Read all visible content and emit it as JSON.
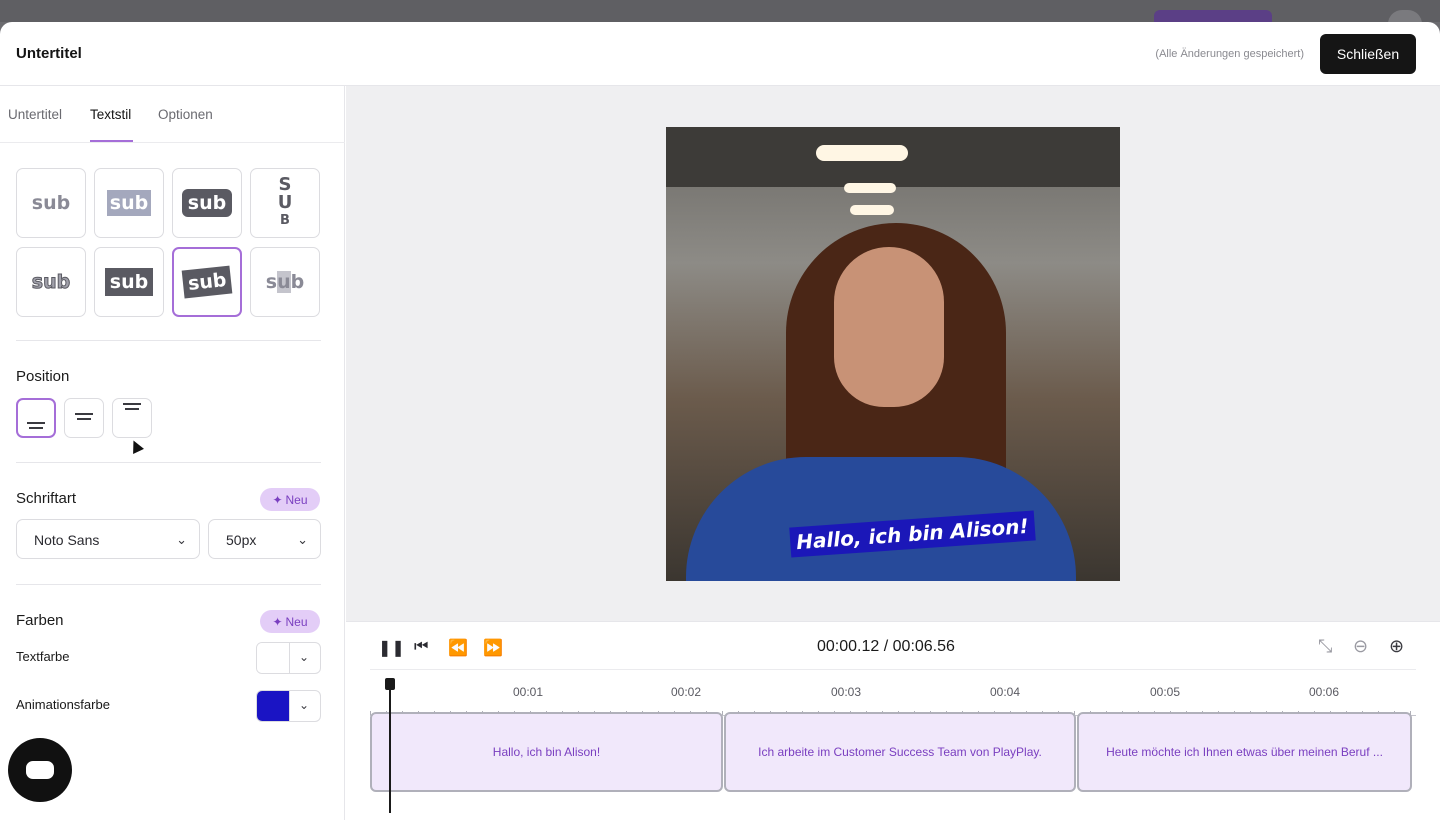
{
  "modal": {
    "title": "Untertitel",
    "saved_status": "(Alle Änderungen gespeichert)",
    "close_label": "Schließen"
  },
  "sidebar": {
    "tabs": [
      {
        "label": "Untertitel",
        "active": false
      },
      {
        "label": "Textstil",
        "active": true
      },
      {
        "label": "Optionen",
        "active": false
      }
    ],
    "styles": {
      "sample": "sub",
      "vertical_letters": [
        "S",
        "U",
        "B"
      ],
      "selected_index": 6
    },
    "position": {
      "title": "Position",
      "options": [
        "bottom",
        "middle",
        "top"
      ],
      "selected": "bottom"
    },
    "font": {
      "title": "Schriftart",
      "badge": "Neu",
      "family": "Noto Sans",
      "size": "50px"
    },
    "colors": {
      "title": "Farben",
      "badge": "Neu",
      "text_color_label": "Textfarbe",
      "text_color": "#ffffff",
      "animation_color_label": "Animationsfarbe",
      "animation_color": "#1a14c4"
    }
  },
  "preview": {
    "caption": "Hallo, ich bin Alison!",
    "caption_bg": "#1b17b8"
  },
  "timeline": {
    "current_time": "00:00.12",
    "separator": "/",
    "total_time": "00:06.56",
    "tick_labels": [
      "00:01",
      "00:02",
      "00:03",
      "00:04",
      "00:05",
      "00:06"
    ],
    "clips": [
      {
        "text": "Hallo, ich bin Alison!"
      },
      {
        "text": "Ich arbeite im Customer Success Team von PlayPlay."
      },
      {
        "text": "Heute möchte ich Ihnen etwas über meinen Beruf ..."
      }
    ]
  },
  "colors": {
    "accent": "#a56ed8",
    "primary_button": "#151515",
    "badge_bg": "#e3cdf7"
  }
}
